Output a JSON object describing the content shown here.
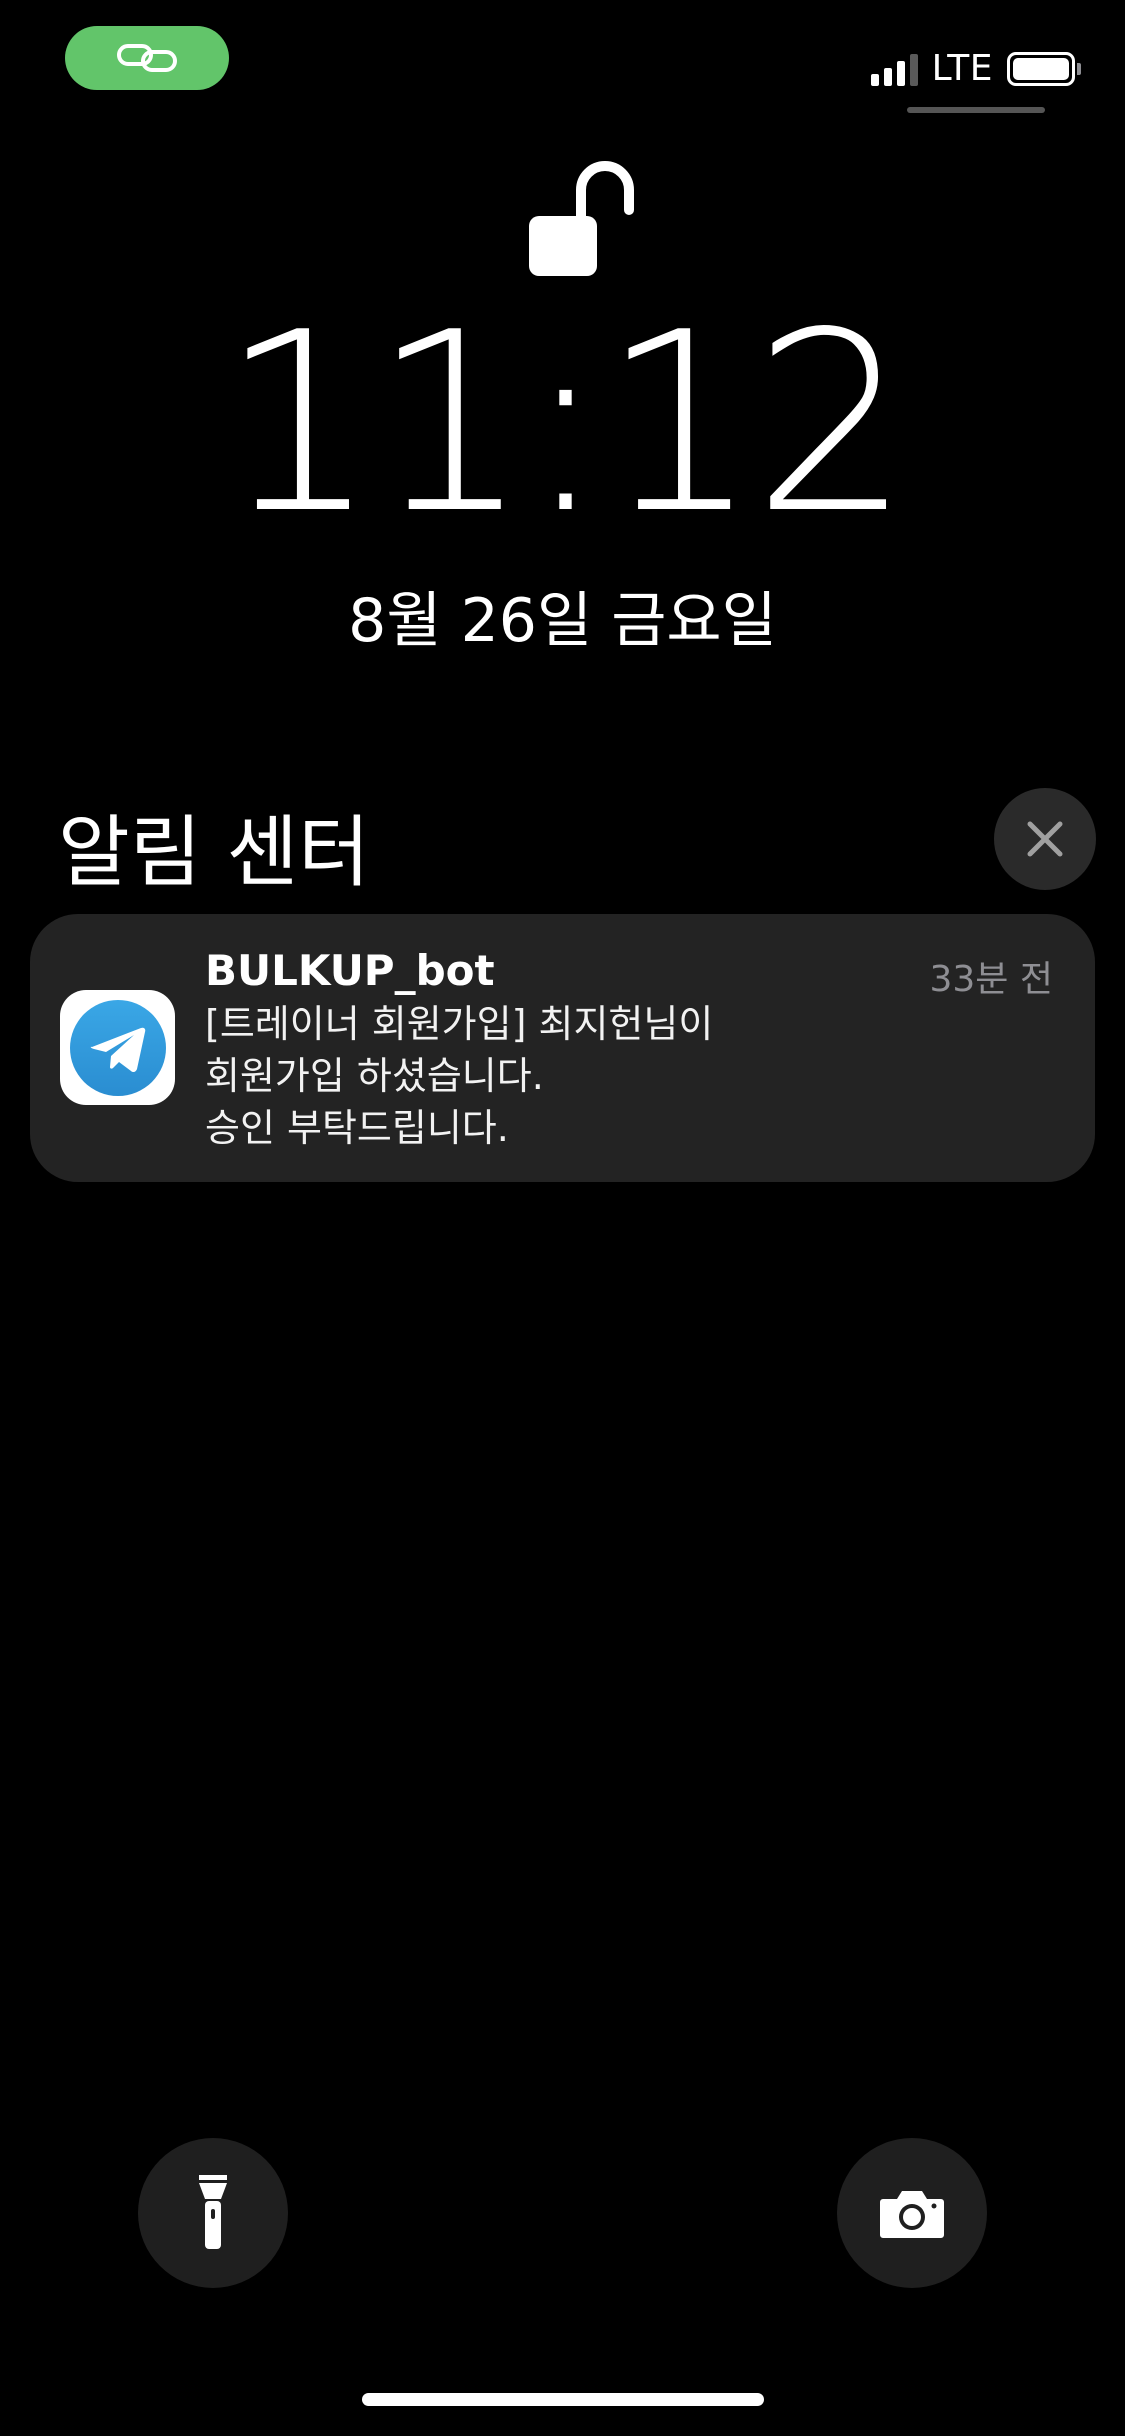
{
  "status_bar": {
    "network": "LTE",
    "signal_bars_active": 3,
    "signal_bars_total": 4,
    "battery_level": 1.0,
    "pill_color": "#62c56a",
    "pill_icon": "link-icon"
  },
  "lock_screen": {
    "lock_icon": "unlocked-padlock-icon",
    "time": "11:12",
    "date": "8월 26일 금요일"
  },
  "notification_center": {
    "title": "알림 센터",
    "close_icon": "close-icon",
    "notifications": [
      {
        "app_icon": "telegram-icon",
        "app_name": "BULKUP_bot",
        "time_ago": "33분 전",
        "body_lines": [
          "[트레이너 회원가입] 최지헌님이",
          "회원가입 하셨습니다.",
          "승인 부탁드립니다."
        ]
      }
    ]
  },
  "quick_actions": {
    "left_icon": "flashlight-icon",
    "right_icon": "camera-icon"
  },
  "colors": {
    "background": "#000000",
    "notification_bg": "#232323",
    "telegram_blue": "#2f9ee0"
  }
}
